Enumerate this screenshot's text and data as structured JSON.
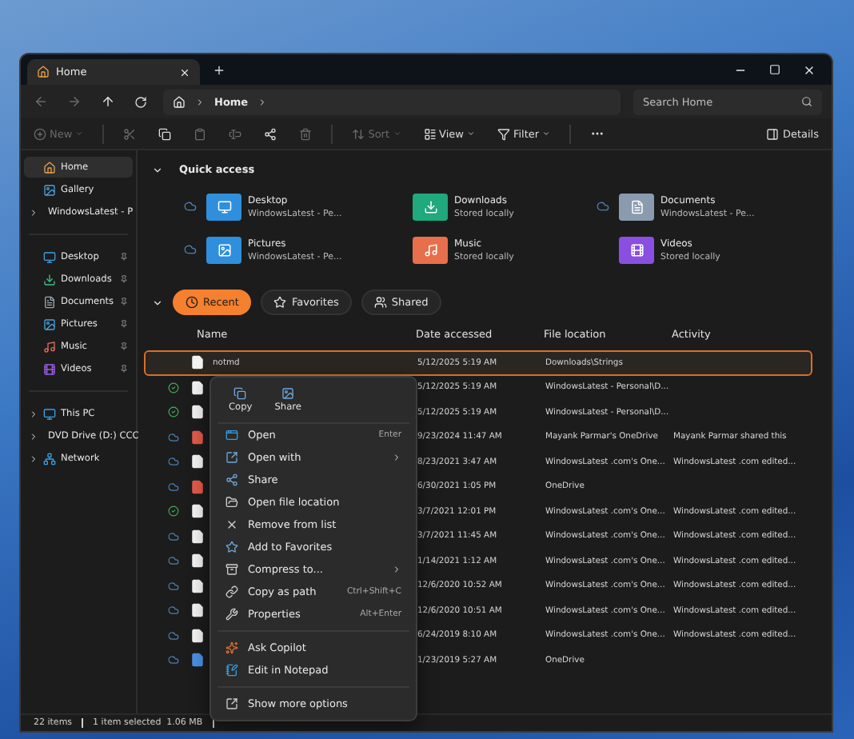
{
  "tab": {
    "title": "Home"
  },
  "address": {
    "crumbs": [
      "Home"
    ]
  },
  "search": {
    "placeholder": "Search Home"
  },
  "toolbar": [
    {
      "label": "New",
      "disabled": true,
      "kind": "dropdown"
    },
    {
      "kind": "icon",
      "disabled": true
    },
    {
      "kind": "icon",
      "disabled": false
    },
    {
      "kind": "icon",
      "disabled": true
    },
    {
      "kind": "icon",
      "disabled": true
    },
    {
      "kind": "icon",
      "disabled": false
    },
    {
      "kind": "icon",
      "disabled": true
    },
    {
      "label": "Sort",
      "disabled": true,
      "kind": "dropdown"
    },
    {
      "label": "View",
      "disabled": false,
      "kind": "dropdown"
    },
    {
      "label": "Filter",
      "disabled": false,
      "kind": "dropdown"
    },
    {
      "kind": "more",
      "disabled": false
    }
  ],
  "details": {
    "label": "Details"
  },
  "sidebar": {
    "top": [
      {
        "label": "Home",
        "selected": true,
        "expandable": false
      },
      {
        "label": "Gallery",
        "selected": false,
        "expandable": false
      },
      {
        "label": "WindowsLatest - P",
        "selected": false,
        "expandable": true
      }
    ],
    "pinned": [
      {
        "label": "Desktop",
        "selected": false
      },
      {
        "label": "Downloads",
        "selected": false
      },
      {
        "label": "Documents",
        "selected": false
      },
      {
        "label": "Pictures",
        "selected": false
      },
      {
        "label": "Music",
        "selected": false
      },
      {
        "label": "Videos",
        "selected": false
      }
    ],
    "drives": [
      {
        "label": "This PC",
        "selected": false
      },
      {
        "label": "DVD Drive (D:) CCC",
        "selected": false
      },
      {
        "label": "Network",
        "selected": false
      }
    ]
  },
  "quick_access": {
    "title": "Quick access",
    "expanded": true,
    "items": [
      {
        "name": "Desktop",
        "detail": "WindowsLatest - Pe...",
        "cloud": true
      },
      {
        "name": "Downloads",
        "detail": "Stored locally",
        "cloud": false
      },
      {
        "name": "Documents",
        "detail": "WindowsLatest - Pe...",
        "cloud": true
      },
      {
        "name": "Pictures",
        "detail": "WindowsLatest - Pe...",
        "cloud": true
      },
      {
        "name": "Music",
        "detail": "Stored locally",
        "cloud": false
      },
      {
        "name": "Videos",
        "detail": "Stored locally",
        "cloud": false
      }
    ]
  },
  "filters": [
    {
      "label": "Recent",
      "selected": true
    },
    {
      "label": "Favorites",
      "selected": false
    },
    {
      "label": "Shared",
      "selected": false
    }
  ],
  "table": {
    "columns": [
      "Name",
      "Date accessed",
      "File location",
      "Activity"
    ],
    "rows": [
      {
        "name": "notmd",
        "date": "5/12/2025 5:19 AM",
        "location": "Downloads\\Strings",
        "selected": true,
        "kind": "plain",
        "color": "#f2f2f2"
      },
      {
        "date": "5/12/2025 5:19 AM",
        "location": "WindowsLatest - Personal\\D...",
        "kind": "synced",
        "selected": false,
        "color": "#f2f2f2"
      },
      {
        "date": "5/12/2025 5:19 AM",
        "location": "WindowsLatest - Personal\\D...",
        "kind": "synced",
        "selected": false,
        "color": "#f2f2f2"
      },
      {
        "date": "9/23/2024 11:47 AM",
        "location": "Mayank Parmar's OneDrive",
        "activity": "Mayank Parmar shared this",
        "kind": "cloud",
        "selected": false,
        "color": "#e05a4a"
      },
      {
        "date": "8/23/2021 3:47 AM",
        "location": "WindowsLatest .com's One...",
        "activity": "WindowsLatest .com edited...",
        "kind": "cloud",
        "selected": false,
        "color": "#f2f2f2"
      },
      {
        "date": "6/30/2021 1:05 PM",
        "location": "OneDrive",
        "kind": "cloud",
        "selected": false,
        "color": "#e05a4a"
      },
      {
        "date": "3/7/2021 12:01 PM",
        "location": "WindowsLatest .com's One...",
        "activity": "WindowsLatest .com edited...",
        "kind": "synced",
        "selected": false,
        "color": "#f2f2f2"
      },
      {
        "date": "3/7/2021 11:45 AM",
        "location": "WindowsLatest .com's One...",
        "activity": "WindowsLatest .com edited...",
        "kind": "cloud",
        "selected": false,
        "color": "#f2f2f2"
      },
      {
        "date": "1/14/2021 1:12 AM",
        "location": "WindowsLatest .com's One...",
        "activity": "WindowsLatest .com edited...",
        "kind": "cloud",
        "selected": false,
        "color": "#f2f2f2"
      },
      {
        "date": "12/6/2020 10:52 AM",
        "location": "WindowsLatest .com's One...",
        "activity": "WindowsLatest .com edited...",
        "kind": "cloud",
        "selected": false,
        "color": "#f2f2f2"
      },
      {
        "date": "12/6/2020 10:51 AM",
        "location": "WindowsLatest .com's One...",
        "activity": "WindowsLatest .com edited...",
        "kind": "cloud",
        "selected": false,
        "color": "#f2f2f2"
      },
      {
        "date": "6/24/2019 8:10 AM",
        "location": "WindowsLatest .com's One...",
        "activity": "WindowsLatest .com edited...",
        "kind": "cloud",
        "selected": false,
        "color": "#f2f2f2"
      },
      {
        "date": "1/23/2019 5:27 AM",
        "location": "OneDrive",
        "kind": "cloud",
        "selected": false,
        "color": "#4a90e2"
      }
    ]
  },
  "context_menu": {
    "quick": [
      "Copy",
      "Share"
    ],
    "groups": [
      [
        {
          "label": "Open",
          "shortcut": "Enter"
        },
        {
          "label": "Open with",
          "submenu": true
        },
        {
          "label": "Share"
        },
        {
          "label": "Open file location"
        },
        {
          "label": "Remove from list"
        },
        {
          "label": "Add to Favorites"
        },
        {
          "label": "Compress to...",
          "submenu": true
        },
        {
          "label": "Copy as path",
          "shortcut": "Ctrl+Shift+C"
        },
        {
          "label": "Properties",
          "shortcut": "Alt+Enter"
        }
      ],
      [
        {
          "label": "Ask Copilot"
        },
        {
          "label": "Edit in Notepad"
        }
      ],
      [
        {
          "label": "Show more options"
        }
      ]
    ]
  },
  "status_bar": [
    "22 items",
    "1 item selected  1.06 MB"
  ]
}
